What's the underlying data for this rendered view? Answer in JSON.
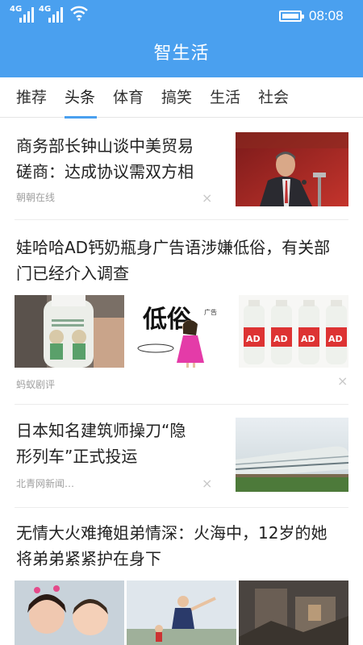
{
  "status": {
    "network1": "4G",
    "network2": "4G",
    "time": "08:08"
  },
  "app": {
    "title": "智生活"
  },
  "tabs": [
    "推荐",
    "头条",
    "体育",
    "搞笑",
    "生活",
    "社会"
  ],
  "active_tab": "头条",
  "articles": [
    {
      "title_l1": "商务部长钟山谈中美贸易",
      "title_l2": "磋商：达成协议需双方相",
      "source": "朝朝在线"
    },
    {
      "title_l1": "娃哈哈AD钙奶瓶身广告语涉嫌低俗，有关部",
      "title_l2": "门已经介入调查",
      "source": "蚂蚁剧评",
      "img_text": "低俗",
      "img_small": "广告"
    },
    {
      "title_l1": "日本知名建筑师操刀“隐",
      "title_l2": "形列车”正式投运",
      "source": "北青网新闻…"
    },
    {
      "title_l1": "无情大火难掩姐弟情深：火海中，12岁的她",
      "title_l2": "将弟弟紧紧护在身下"
    }
  ],
  "close_glyph": "×",
  "colors": {
    "accent": "#4aa0ef"
  }
}
